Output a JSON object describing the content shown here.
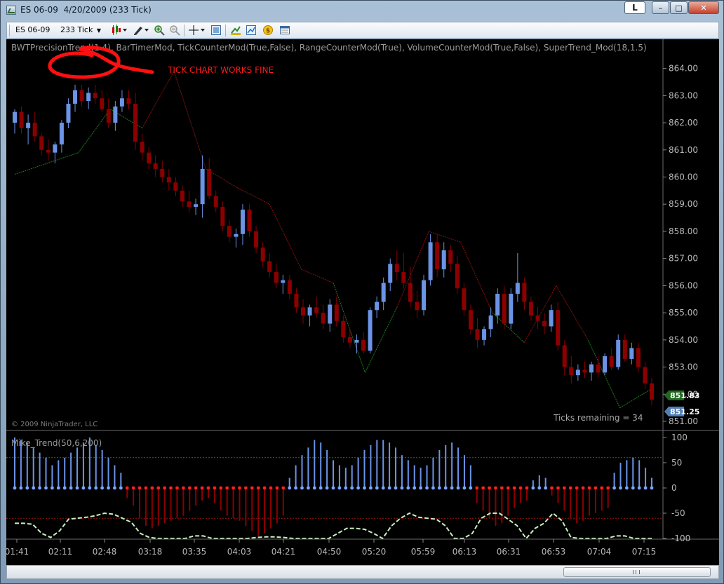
{
  "window": {
    "title": "ES 06-09  4/20/2009 (233 Tick)",
    "link_button": "L",
    "minimize": "–",
    "maximize": "□",
    "close": "✕"
  },
  "toolbar": {
    "instrument": "ES 06-09",
    "period": "233 Tick",
    "icons": [
      "chart-style-icon",
      "pencil-icon",
      "zoom-in-icon",
      "zoom-out-icon",
      "crosshair-icon",
      "properties-icon",
      "indicators-icon",
      "strategies-icon",
      "money-icon",
      "data-box-icon"
    ]
  },
  "chart": {
    "indicator_label": "BWTPrecisionTrend(1.4), BarTimerMod, TickCounterMod(True,False), RangeCounterMod(True), VolumeCounterMod(True,False), SuperTrend_Mod(18,1.5)",
    "annotation": "TICK CHART WORKS FINE",
    "copyright": "© 2009 NinjaTrader, LLC",
    "ticks_remaining": "Ticks remaining = 34",
    "price_labels": [
      "864.00",
      "863.00",
      "862.00",
      "861.00",
      "860.00",
      "859.00",
      "858.00",
      "857.00",
      "856.00",
      "855.00",
      "854.00",
      "853.00",
      "852.00",
      "851.00"
    ],
    "last_price_green": "851.83",
    "last_price_blue": "851.25",
    "lower_label": "Mike_Trend(50,6,200)",
    "lower_ticks": [
      "100",
      "50",
      "0",
      "-50",
      "-100"
    ],
    "time_labels": [
      "01:41",
      "02:11",
      "02:48",
      "03:18",
      "03:35",
      "04:03",
      "04:21",
      "04:50",
      "05:20",
      "05:59",
      "06:13",
      "06:31",
      "06:53",
      "07:04",
      "07:15"
    ],
    "colors": {
      "up": "#6b93e6",
      "down": "#8b0000",
      "supertrend_up": "#1f7a1f",
      "supertrend_down": "#8a0f0f",
      "annotation": "#ff1a1a"
    }
  },
  "chart_data": {
    "type": "candlestick",
    "ylim": [
      851,
      864.3
    ],
    "candles": [
      [
        862.0,
        862.5,
        861.6,
        862.4
      ],
      [
        862.4,
        862.6,
        861.6,
        861.8
      ],
      [
        861.8,
        862.3,
        861.2,
        862.0
      ],
      [
        862.0,
        862.4,
        861.3,
        861.5
      ],
      [
        861.5,
        861.6,
        860.8,
        861.0
      ],
      [
        861.0,
        861.4,
        860.6,
        860.9
      ],
      [
        860.9,
        861.3,
        860.5,
        861.2
      ],
      [
        861.2,
        862.1,
        860.9,
        862.0
      ],
      [
        862.0,
        862.9,
        861.8,
        862.7
      ],
      [
        862.7,
        863.4,
        862.4,
        863.2
      ],
      [
        863.2,
        863.4,
        862.6,
        862.8
      ],
      [
        862.8,
        863.3,
        862.5,
        863.1
      ],
      [
        863.1,
        863.4,
        862.7,
        862.9
      ],
      [
        862.9,
        863.2,
        862.4,
        862.5
      ],
      [
        862.5,
        862.9,
        861.8,
        862.0
      ],
      [
        862.0,
        862.8,
        861.7,
        862.6
      ],
      [
        862.6,
        863.2,
        862.4,
        862.9
      ],
      [
        862.9,
        863.2,
        862.5,
        862.7
      ],
      [
        862.7,
        863.1,
        861.0,
        861.3
      ],
      [
        861.3,
        861.6,
        860.6,
        860.9
      ],
      [
        860.9,
        861.1,
        860.3,
        860.5
      ],
      [
        860.5,
        860.8,
        860.0,
        860.3
      ],
      [
        860.3,
        860.6,
        859.8,
        860.0
      ],
      [
        860.0,
        860.3,
        859.5,
        859.8
      ],
      [
        859.8,
        860.0,
        859.3,
        859.5
      ],
      [
        859.5,
        859.7,
        858.9,
        859.1
      ],
      [
        859.1,
        859.5,
        858.7,
        858.9
      ],
      [
        858.9,
        859.2,
        858.6,
        859.0
      ],
      [
        859.0,
        860.8,
        858.5,
        860.3
      ],
      [
        860.3,
        860.7,
        859.2,
        859.3
      ],
      [
        859.3,
        859.5,
        858.7,
        858.9
      ],
      [
        858.9,
        859.1,
        858.0,
        858.2
      ],
      [
        858.2,
        858.4,
        857.6,
        857.8
      ],
      [
        857.8,
        858.1,
        857.4,
        857.9
      ],
      [
        857.9,
        859.0,
        857.5,
        858.8
      ],
      [
        858.8,
        859.0,
        857.8,
        858.0
      ],
      [
        858.0,
        858.2,
        857.2,
        857.4
      ],
      [
        857.4,
        857.6,
        856.7,
        856.9
      ],
      [
        856.9,
        857.2,
        856.3,
        856.5
      ],
      [
        856.5,
        856.8,
        855.9,
        856.1
      ],
      [
        856.1,
        856.4,
        855.7,
        856.2
      ],
      [
        856.2,
        856.4,
        855.5,
        855.7
      ],
      [
        855.7,
        855.9,
        855.0,
        855.2
      ],
      [
        855.2,
        855.5,
        854.6,
        854.9
      ],
      [
        854.9,
        855.3,
        854.5,
        855.2
      ],
      [
        855.2,
        855.6,
        854.8,
        855.0
      ],
      [
        855.0,
        855.3,
        854.4,
        854.6
      ],
      [
        854.6,
        855.5,
        854.3,
        855.3
      ],
      [
        855.3,
        855.6,
        854.5,
        854.7
      ],
      [
        854.7,
        854.9,
        853.9,
        854.1
      ],
      [
        854.1,
        854.4,
        853.7,
        853.9
      ],
      [
        853.9,
        854.2,
        853.5,
        854.0
      ],
      [
        854.0,
        854.3,
        853.5,
        853.6
      ],
      [
        853.6,
        855.2,
        853.5,
        855.1
      ],
      [
        855.1,
        855.6,
        854.8,
        855.4
      ],
      [
        855.4,
        856.3,
        855.1,
        856.1
      ],
      [
        856.1,
        857.0,
        855.8,
        856.8
      ],
      [
        856.8,
        857.3,
        856.2,
        856.5
      ],
      [
        856.5,
        857.2,
        855.9,
        856.1
      ],
      [
        856.1,
        856.7,
        855.2,
        855.4
      ],
      [
        855.4,
        855.8,
        854.8,
        855.1
      ],
      [
        855.1,
        856.4,
        854.9,
        856.2
      ],
      [
        856.2,
        857.9,
        856.0,
        857.6
      ],
      [
        857.6,
        857.9,
        856.3,
        856.6
      ],
      [
        856.6,
        857.6,
        856.3,
        857.3
      ],
      [
        857.3,
        857.5,
        856.5,
        856.8
      ],
      [
        856.8,
        857.1,
        855.7,
        855.9
      ],
      [
        855.9,
        856.1,
        854.9,
        855.1
      ],
      [
        855.1,
        855.3,
        854.2,
        854.4
      ],
      [
        854.4,
        854.8,
        853.7,
        854.0
      ],
      [
        854.0,
        854.5,
        853.8,
        854.4
      ],
      [
        854.4,
        855.2,
        854.1,
        854.9
      ],
      [
        854.9,
        855.9,
        854.6,
        855.7
      ],
      [
        855.7,
        856.0,
        854.4,
        854.6
      ],
      [
        854.6,
        855.9,
        854.4,
        855.7
      ],
      [
        855.7,
        857.2,
        855.4,
        856.1
      ],
      [
        856.1,
        856.3,
        855.1,
        855.4
      ],
      [
        855.4,
        855.6,
        854.7,
        854.9
      ],
      [
        854.9,
        855.2,
        854.4,
        854.7
      ],
      [
        854.7,
        855.0,
        854.2,
        854.5
      ],
      [
        854.5,
        855.3,
        854.3,
        855.1
      ],
      [
        855.1,
        855.4,
        853.6,
        853.8
      ],
      [
        853.8,
        854.0,
        852.7,
        853.0
      ],
      [
        853.0,
        853.4,
        852.4,
        852.7
      ],
      [
        852.7,
        853.1,
        852.5,
        852.9
      ],
      [
        852.9,
        853.2,
        852.6,
        852.8
      ],
      [
        852.8,
        853.2,
        852.5,
        853.1
      ],
      [
        853.1,
        853.4,
        852.6,
        852.8
      ],
      [
        852.8,
        853.5,
        852.7,
        853.4
      ],
      [
        853.4,
        853.7,
        852.9,
        853.0
      ],
      [
        853.0,
        854.2,
        852.9,
        854.0
      ],
      [
        854.0,
        854.2,
        853.2,
        853.3
      ],
      [
        853.3,
        853.9,
        853.1,
        853.7
      ],
      [
        853.7,
        853.9,
        852.8,
        853.0
      ],
      [
        853.0,
        853.2,
        852.2,
        852.4
      ],
      [
        852.4,
        852.6,
        851.6,
        851.8
      ]
    ],
    "supertrend": [
      [
        860.1,
        "up"
      ],
      [
        860.5,
        "up"
      ],
      [
        860.9,
        "up"
      ],
      [
        862.5,
        "up"
      ],
      [
        861.8,
        "up"
      ],
      [
        863.9,
        "down"
      ],
      [
        860.3,
        "down"
      ],
      [
        859.6,
        "down"
      ],
      [
        859.0,
        "down"
      ],
      [
        856.6,
        "down"
      ],
      [
        856.1,
        "down"
      ],
      [
        852.8,
        "up"
      ],
      [
        855.2,
        "up"
      ],
      [
        858.0,
        "down"
      ],
      [
        857.6,
        "down"
      ],
      [
        855.0,
        "down"
      ],
      [
        853.9,
        "up"
      ],
      [
        856.0,
        "down"
      ],
      [
        854.0,
        "down"
      ],
      [
        851.5,
        "up"
      ],
      [
        852.2,
        "up"
      ]
    ],
    "oscillator": {
      "ylim": [
        -100,
        100
      ],
      "levels": [
        60,
        0,
        -60
      ],
      "bars": [
        100,
        95,
        90,
        80,
        70,
        60,
        45,
        55,
        60,
        70,
        80,
        90,
        100,
        85,
        75,
        60,
        45,
        30,
        -20,
        -35,
        -60,
        -75,
        -80,
        -75,
        -70,
        -65,
        -60,
        -55,
        -45,
        -35,
        -25,
        -20,
        -30,
        -45,
        -55,
        -60,
        -65,
        -75,
        -85,
        -95,
        -90,
        -80,
        -70,
        -55,
        20,
        45,
        65,
        80,
        95,
        90,
        75,
        55,
        45,
        40,
        45,
        60,
        75,
        85,
        95,
        95,
        90,
        80,
        65,
        55,
        45,
        40,
        45,
        60,
        75,
        85,
        90,
        80,
        65,
        45,
        -30,
        -45,
        -60,
        -75,
        -70,
        -55,
        -40,
        -30,
        -25,
        15,
        25,
        20,
        -15,
        -30,
        -45,
        -60,
        -70,
        -65,
        -55,
        -50,
        -45,
        -40,
        30,
        50,
        55,
        60,
        55,
        40,
        20
      ],
      "signal": [
        -70,
        -70,
        -72,
        -90,
        -98,
        -85,
        -62,
        -60,
        -58,
        -55,
        -50,
        -52,
        -60,
        -68,
        -90,
        -98,
        -100,
        -100,
        -100,
        -100,
        -95,
        -95,
        -100,
        -100,
        -100,
        -100,
        -100,
        -98,
        -97,
        -97,
        -98,
        -100,
        -100,
        -100,
        -100,
        -100,
        -90,
        -80,
        -80,
        -82,
        -90,
        -100,
        -75,
        -60,
        -50,
        -58,
        -60,
        -62,
        -75,
        -100,
        -100,
        -90,
        -60,
        -50,
        -50,
        -62,
        -75,
        -100,
        -80,
        -70,
        -50,
        -65,
        -98,
        -100,
        -100,
        -100,
        -100,
        -95,
        -95,
        -100,
        -100,
        -100
      ]
    },
    "time_labels": [
      "01:41",
      "02:11",
      "02:48",
      "03:18",
      "03:35",
      "04:03",
      "04:21",
      "04:50",
      "05:20",
      "05:59",
      "06:13",
      "06:31",
      "06:53",
      "07:04",
      "07:15"
    ]
  }
}
